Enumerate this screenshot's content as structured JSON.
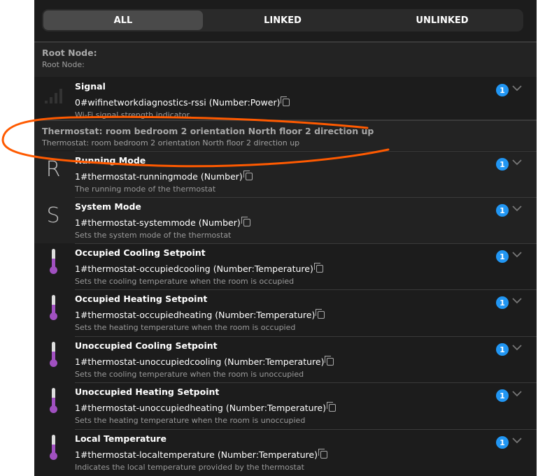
{
  "tabs": [
    {
      "label": "ALL",
      "active": true
    },
    {
      "label": "LINKED"
    },
    {
      "label": "UNLINKED"
    }
  ],
  "groups": [
    {
      "title": "Root Node:",
      "subtitle": "Root Node:"
    },
    {
      "title": "Thermostat: room bedroom 2 orientation North floor 2 direction up",
      "subtitle": "Thermostat: room bedroom 2 orientation North floor 2 direction up"
    }
  ],
  "channels": [
    {
      "icon": "signal-icon",
      "name": "Signal",
      "channel": "0#wifinetworkdiagnostics-rssi (Number:Power)",
      "description": "Wi-Fi signal strength indicator.",
      "count": "1"
    },
    {
      "icon": "letter-r-icon",
      "letter": "R",
      "name": "Running Mode",
      "channel": "1#thermostat-runningmode (Number)",
      "description": "The running mode of the thermostat",
      "count": "1"
    },
    {
      "icon": "letter-s-icon",
      "letter": "S",
      "name": "System Mode",
      "channel": "1#thermostat-systemmode (Number)",
      "description": "Sets the system mode of the thermostat",
      "count": "1"
    },
    {
      "icon": "thermometer-icon",
      "name": "Occupied Cooling Setpoint",
      "channel": "1#thermostat-occupiedcooling (Number:Temperature)",
      "description": "Sets the cooling temperature when the room is occupied",
      "count": "1"
    },
    {
      "icon": "thermometer-icon",
      "name": "Occupied Heating Setpoint",
      "channel": "1#thermostat-occupiedheating (Number:Temperature)",
      "description": "Sets the heating temperature when the room is occupied",
      "count": "1"
    },
    {
      "icon": "thermometer-icon",
      "name": "Unoccupied Cooling Setpoint",
      "channel": "1#thermostat-unoccupiedcooling (Number:Temperature)",
      "description": "Sets the cooling temperature when the room is unoccupied",
      "count": "1"
    },
    {
      "icon": "thermometer-icon",
      "name": "Unoccupied Heating Setpoint",
      "channel": "1#thermostat-unoccupiedheating (Number:Temperature)",
      "description": "Sets the heating temperature when the room is unoccupied",
      "count": "1"
    },
    {
      "icon": "thermometer-icon",
      "name": "Local Temperature",
      "channel": "1#thermostat-localtemperature (Number:Temperature)",
      "description": "Indicates the local temperature provided by the thermostat",
      "count": "1"
    }
  ],
  "colors": {
    "accent": "#2196f3",
    "annotation": "#ff5a00",
    "thermometer": "#a050c0"
  }
}
